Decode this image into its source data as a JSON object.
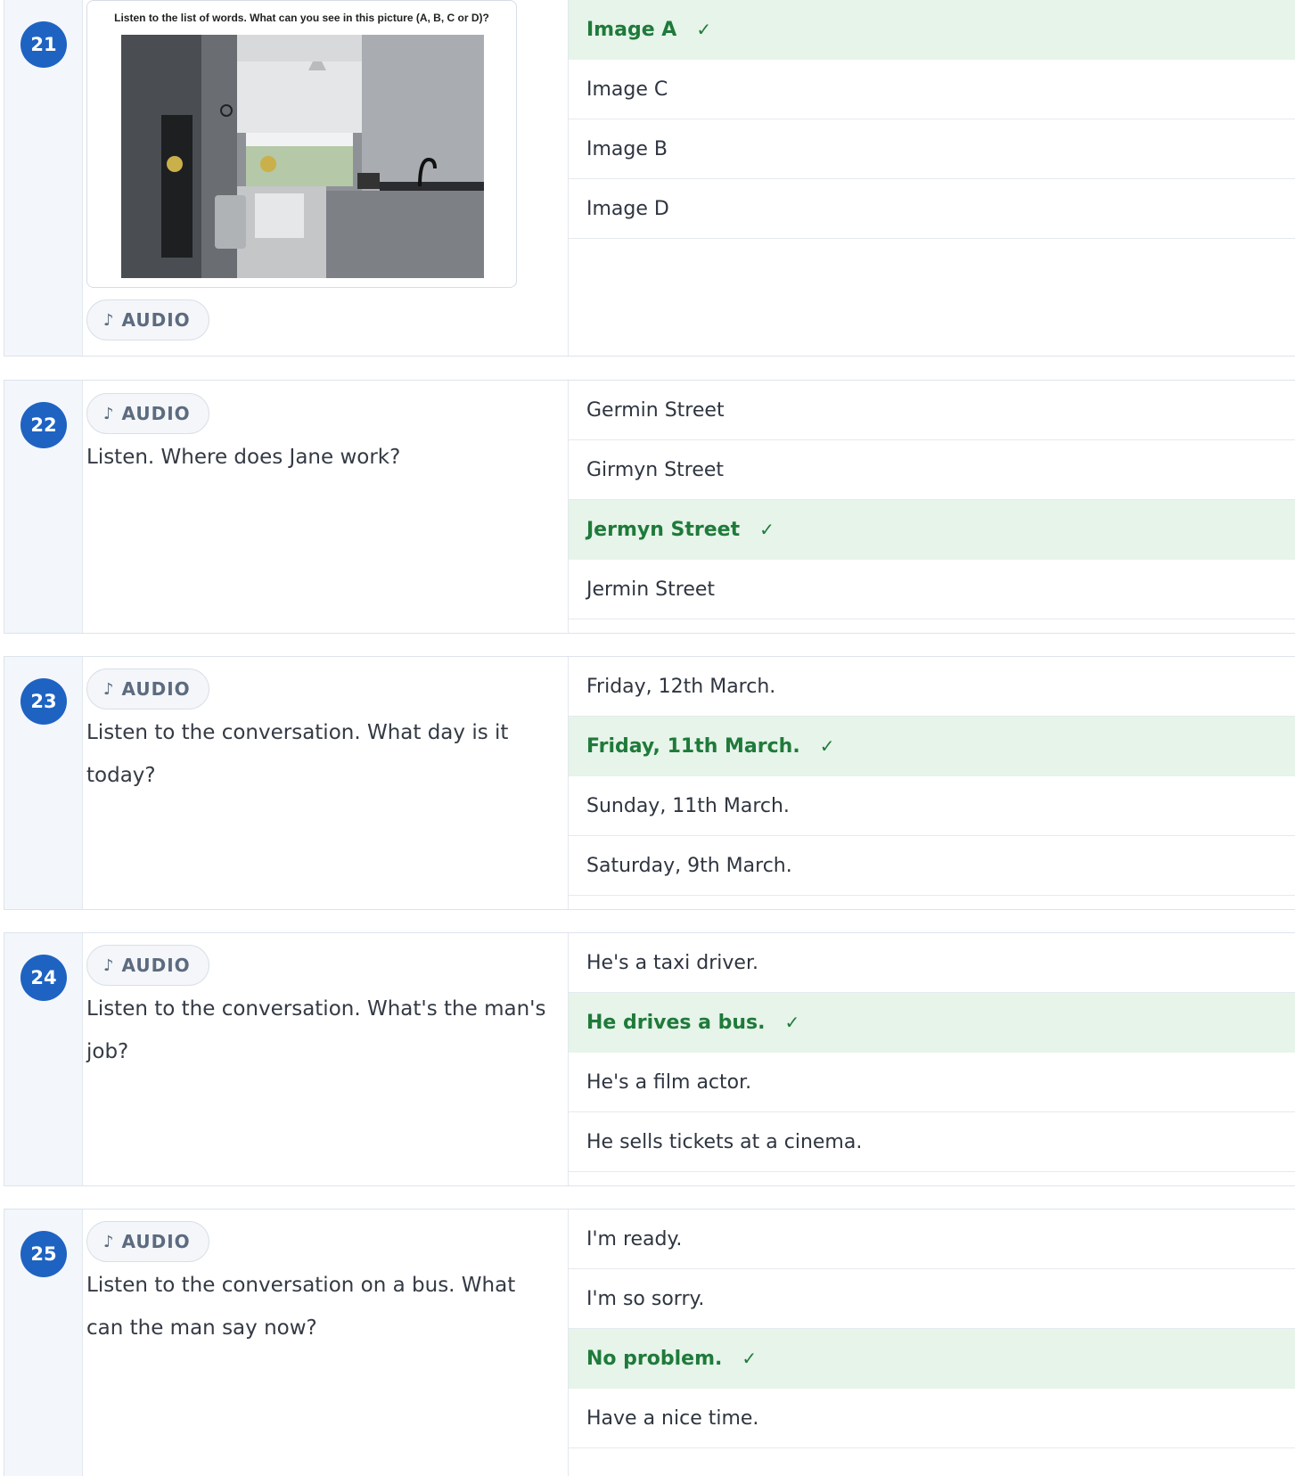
{
  "icons": {
    "audio": "music-note-icon",
    "check": "check-icon"
  },
  "colors": {
    "badge": "#1e63c2",
    "correct_bg": "#e6f4ea",
    "correct_text": "#1f7a3a"
  },
  "questions": [
    {
      "number": "21",
      "audio_label": "AUDIO",
      "audio_glyph": "♪",
      "image_caption": "Listen to the list of words. What can you see in this picture (A, B, C or D)?",
      "options": [
        {
          "label": "Image A",
          "correct": true
        },
        {
          "label": "Image C",
          "correct": false
        },
        {
          "label": "Image B",
          "correct": false
        },
        {
          "label": "Image D",
          "correct": false
        }
      ]
    },
    {
      "number": "22",
      "audio_label": "AUDIO",
      "audio_glyph": "♪",
      "text": "Listen. Where does Jane work?",
      "options": [
        {
          "label": "Germin Street",
          "correct": false
        },
        {
          "label": "Girmyn Street",
          "correct": false
        },
        {
          "label": "Jermyn Street",
          "correct": true
        },
        {
          "label": "Jermin Street",
          "correct": false
        }
      ]
    },
    {
      "number": "23",
      "audio_label": "AUDIO",
      "audio_glyph": "♪",
      "text": "Listen to the conversation. What day is it today?",
      "options": [
        {
          "label": "Friday, 12th March.",
          "correct": false
        },
        {
          "label": "Friday, 11th March.",
          "correct": true
        },
        {
          "label": "Sunday, 11th March.",
          "correct": false
        },
        {
          "label": "Saturday, 9th March.",
          "correct": false
        }
      ]
    },
    {
      "number": "24",
      "audio_label": "AUDIO",
      "audio_glyph": "♪",
      "text": "Listen to the conversation. What's the man's job?",
      "options": [
        {
          "label": "He's a taxi driver.",
          "correct": false
        },
        {
          "label": "He drives a bus.",
          "correct": true
        },
        {
          "label": "He's a film actor.",
          "correct": false
        },
        {
          "label": "He sells tickets at a cinema.",
          "correct": false
        }
      ]
    },
    {
      "number": "25",
      "audio_label": "AUDIO",
      "audio_glyph": "♪",
      "text": "Listen to the conversation on a bus. What can the man say now?",
      "options": [
        {
          "label": "I'm ready.",
          "correct": false
        },
        {
          "label": "I'm so sorry.",
          "correct": false
        },
        {
          "label": "No problem.",
          "correct": true
        },
        {
          "label": "Have a nice time.",
          "correct": false
        }
      ]
    }
  ],
  "check_glyph": "✓"
}
